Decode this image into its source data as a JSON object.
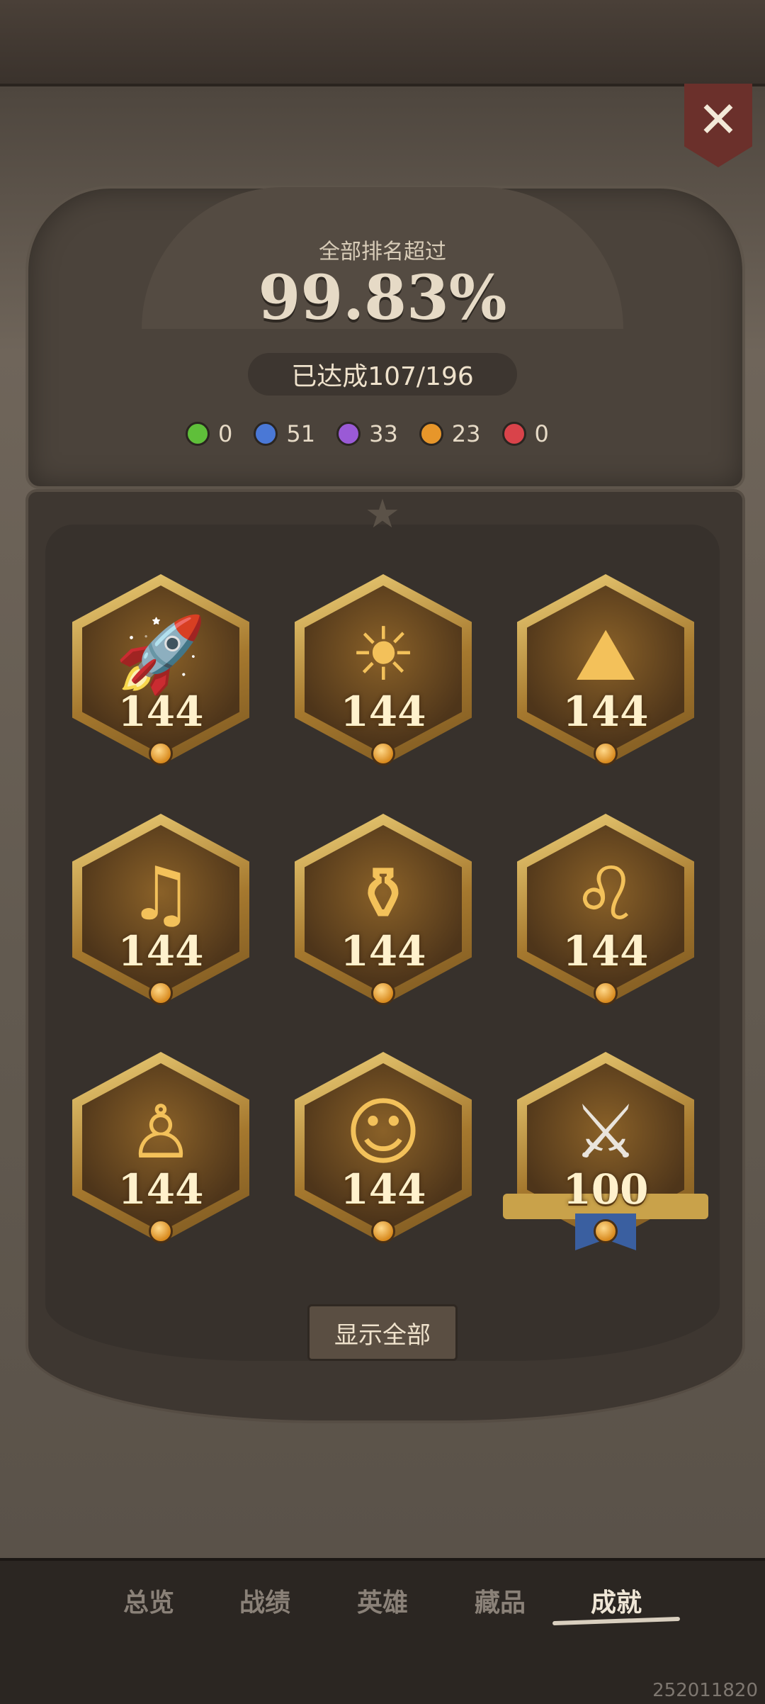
{
  "rank": {
    "label": "全部排名超过",
    "value": "99.83%"
  },
  "achieved": "已达成107/196",
  "gems": [
    {
      "color": "#5fbf3a",
      "icon": "green-moon-icon",
      "value": "0"
    },
    {
      "color": "#4a78d6",
      "icon": "blue-moon-icon",
      "value": "51"
    },
    {
      "color": "#9a5ad6",
      "icon": "purple-moon-icon",
      "value": "33"
    },
    {
      "color": "#e7962a",
      "icon": "orange-orb-icon",
      "value": "23"
    },
    {
      "color": "#d9434a",
      "icon": "red-orb-icon",
      "value": "0"
    }
  ],
  "badges": [
    {
      "icon": "rocket-icon",
      "glyph": "🚀",
      "level": "144"
    },
    {
      "icon": "sun-girl-icon",
      "glyph": "☀",
      "level": "144"
    },
    {
      "icon": "mountain-icon",
      "glyph": "⛰",
      "level": "144"
    },
    {
      "icon": "music-record-icon",
      "glyph": "♫",
      "level": "144"
    },
    {
      "icon": "gourd-icon",
      "glyph": "⚱",
      "level": "144"
    },
    {
      "icon": "lion-icon",
      "glyph": "♌",
      "level": "144"
    },
    {
      "icon": "doll-icon",
      "glyph": "♙",
      "level": "144"
    },
    {
      "icon": "girl-face-icon",
      "glyph": "☺",
      "level": "144"
    },
    {
      "icon": "crossed-swords-icon",
      "glyph": "⚔",
      "level": "100"
    }
  ],
  "show_all": "显示全部",
  "nav": [
    {
      "label": "总览",
      "active": false
    },
    {
      "label": "战绩",
      "active": false
    },
    {
      "label": "英雄",
      "active": false
    },
    {
      "label": "藏品",
      "active": false
    },
    {
      "label": "成就",
      "active": true
    }
  ],
  "close_glyph": "✕",
  "version": "252011820"
}
